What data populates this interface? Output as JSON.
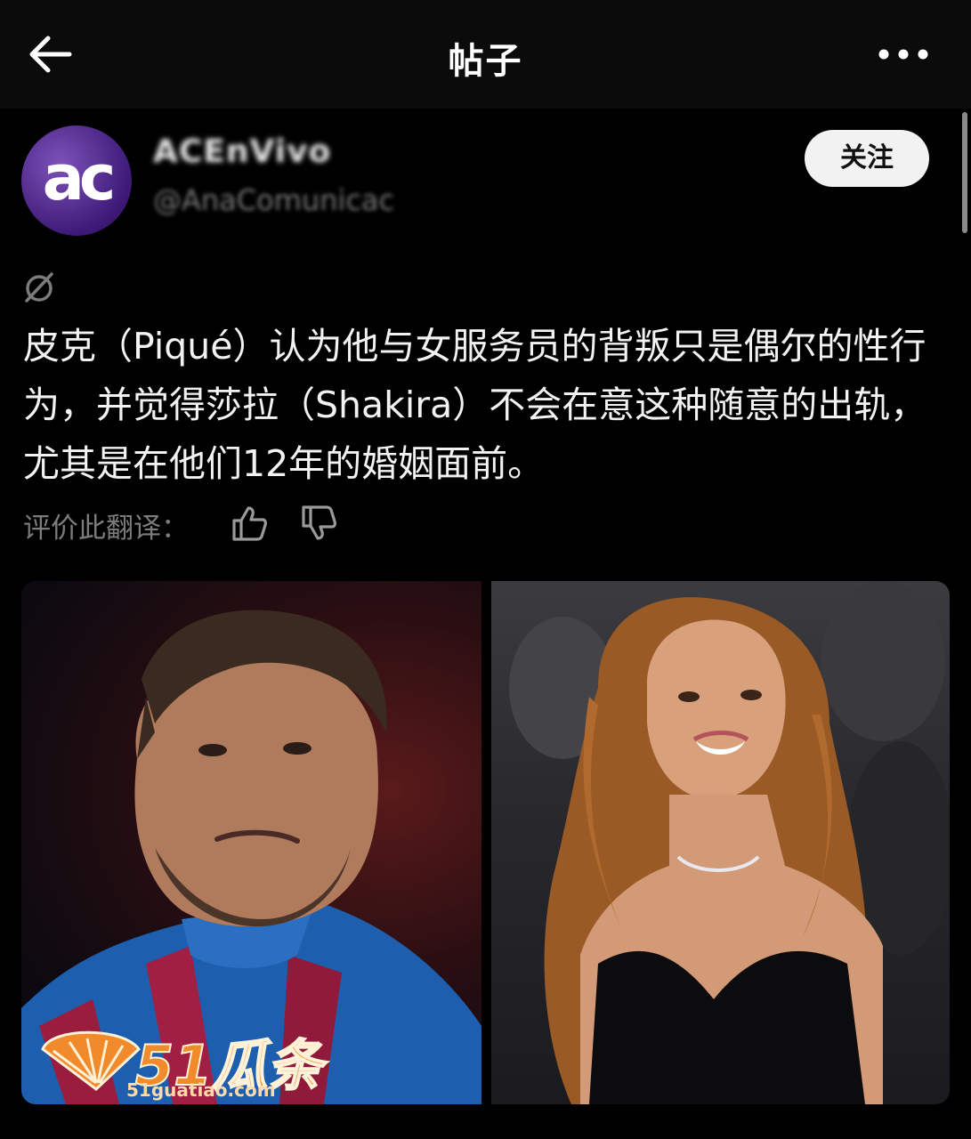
{
  "header": {
    "title": "帖子"
  },
  "post": {
    "avatar_text": "ac",
    "display_name": "ACEnVivo",
    "handle": "@AnaComunicac",
    "follow_label": "关注",
    "text": "皮克（Piqué）认为他与女服务员的背叛只是偶尔的性行为，并觉得莎拉（Shakira）不会在意这种随意的出轨，尤其是在他们12年的婚姻面前。",
    "rate_label": "评价此翻译："
  },
  "media": {
    "watermark": "51瓜条",
    "watermark_url": "51guatiao.com"
  },
  "colors": {
    "background": "#000000",
    "topbar": "#0b0b0b",
    "follow_bg": "#f2f2f2",
    "muted_text": "#7c7c7c",
    "watermark": "#f08a2a"
  },
  "icons": [
    "back-arrow-icon",
    "more-icon",
    "translate-icon",
    "thumb-up-icon",
    "thumb-down-icon"
  ]
}
